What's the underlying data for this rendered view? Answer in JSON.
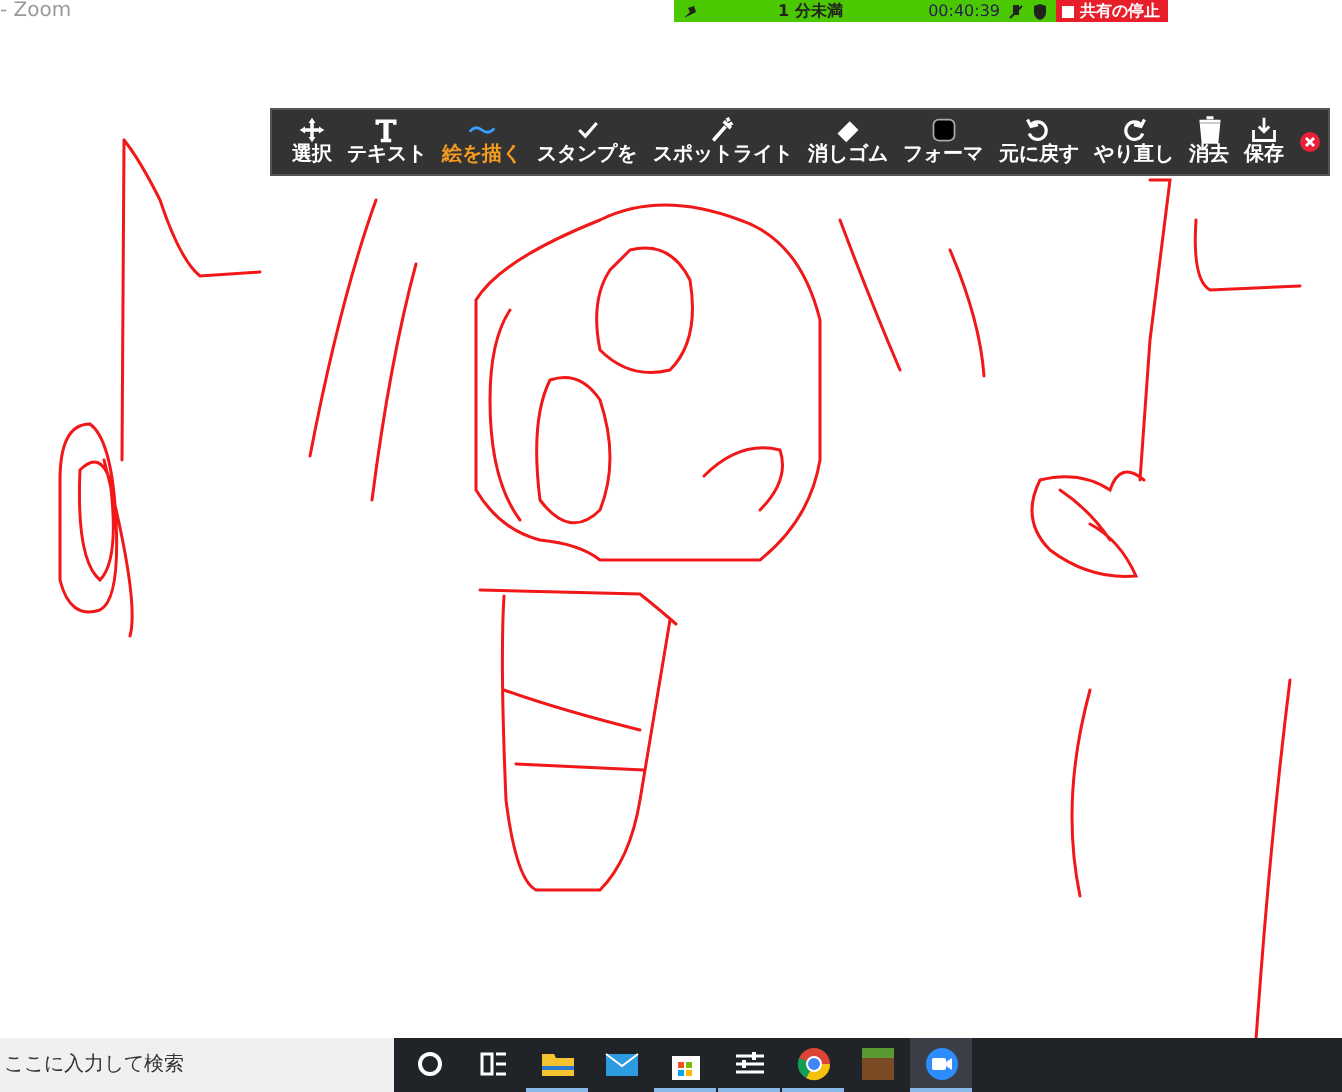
{
  "window": {
    "title": "- Zoom"
  },
  "meeting_bar": {
    "status": "1 分未満",
    "timer": "00:40:39",
    "stop_share_button": "共有の停止"
  },
  "annotation_toolbar": {
    "tools": [
      {
        "kind": "select",
        "label": "選択",
        "selected": false
      },
      {
        "kind": "text",
        "label": "テキスト",
        "selected": false
      },
      {
        "kind": "draw",
        "label": "絵を描く",
        "selected": true
      },
      {
        "kind": "stamp",
        "label": "スタンプを",
        "selected": false
      },
      {
        "kind": "spotlight",
        "label": "スポットライト",
        "selected": false
      },
      {
        "kind": "eraser",
        "label": "消しゴム",
        "selected": false
      },
      {
        "kind": "format",
        "label": "フォーマ",
        "selected": false
      },
      {
        "kind": "undo",
        "label": "元に戻す",
        "selected": false
      },
      {
        "kind": "redo",
        "label": "やり直し",
        "selected": false
      },
      {
        "kind": "clear",
        "label": "消去",
        "selected": false
      },
      {
        "kind": "save",
        "label": "保存",
        "selected": false
      }
    ]
  },
  "taskbar": {
    "search": {
      "placeholder": "ここに入力して検索"
    },
    "apps": [
      {
        "kind": "cortana",
        "running": false,
        "selected": false
      },
      {
        "kind": "taskview",
        "running": false,
        "selected": false
      },
      {
        "kind": "explorer",
        "running": true,
        "selected": false
      },
      {
        "kind": "mail",
        "running": false,
        "selected": false
      },
      {
        "kind": "store",
        "running": true,
        "selected": false
      },
      {
        "kind": "sliders",
        "running": true,
        "selected": false
      },
      {
        "kind": "chrome",
        "running": true,
        "selected": false
      },
      {
        "kind": "minecraft",
        "running": false,
        "selected": false
      },
      {
        "kind": "zoom",
        "running": true,
        "selected": true
      }
    ]
  }
}
